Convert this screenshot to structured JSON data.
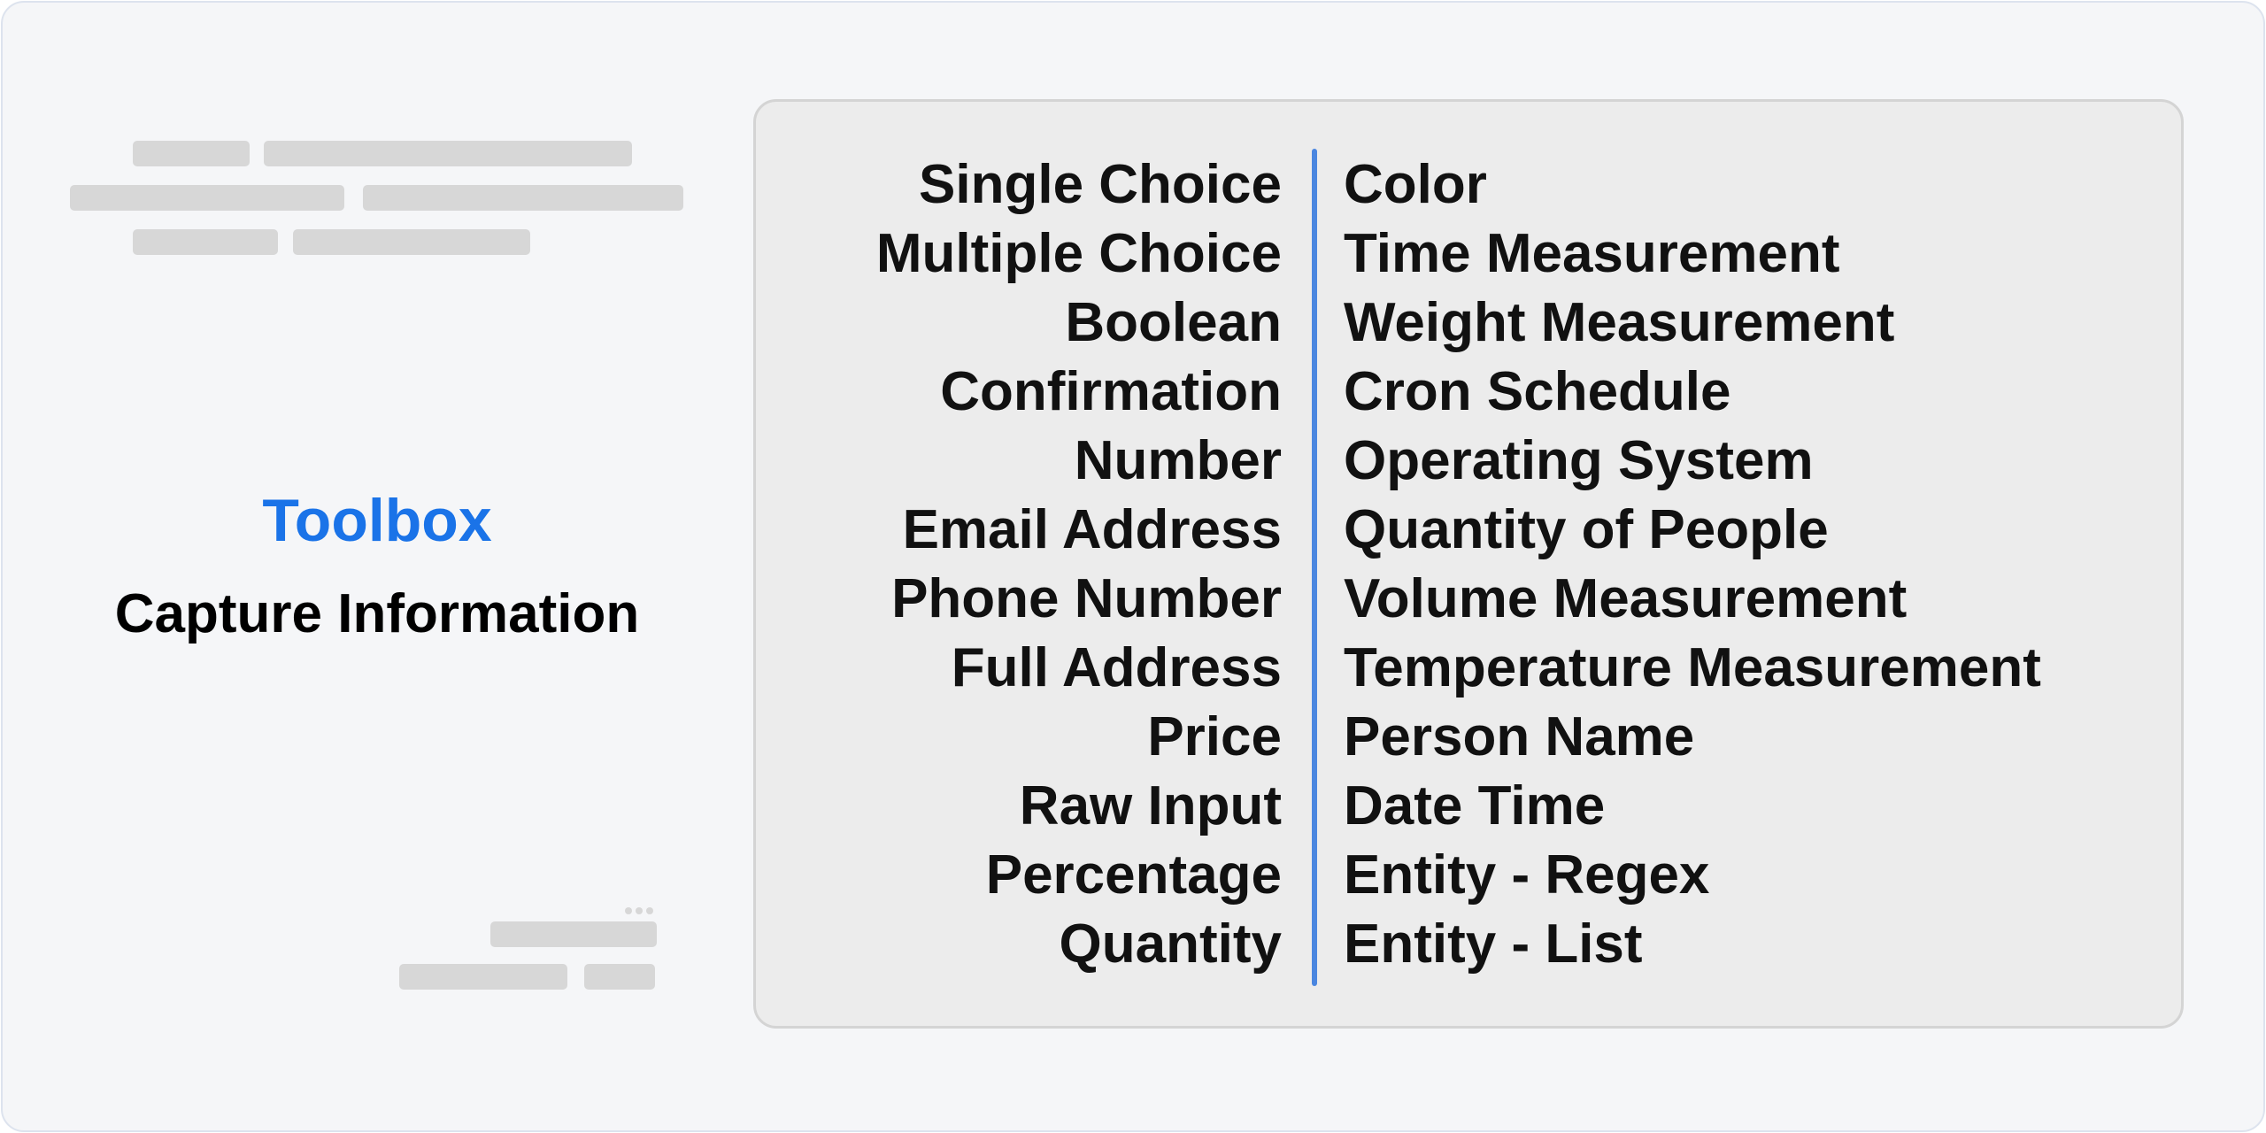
{
  "heading": {
    "title": "Toolbox",
    "subtitle": "Capture Information"
  },
  "left_column": [
    "Single Choice",
    "Multiple Choice",
    "Boolean",
    "Confirmation",
    "Number",
    "Email Address",
    "Phone Number",
    "Full Address",
    "Price",
    "Raw Input",
    "Percentage",
    "Quantity"
  ],
  "right_column": [
    "Color",
    "Time Measurement",
    "Weight Measurement",
    "Cron Schedule",
    "Operating System",
    "Quantity of People",
    "Volume Measurement",
    "Temperature Measurement",
    "Person Name",
    "Date Time",
    "Entity - Regex",
    "Entity - List"
  ],
  "colors": {
    "title": "#1a73e8",
    "divider": "#4a86e0",
    "panel_background": "#ececec",
    "page_background": "#f5f6f8",
    "placeholder": "#d7d7d7"
  }
}
